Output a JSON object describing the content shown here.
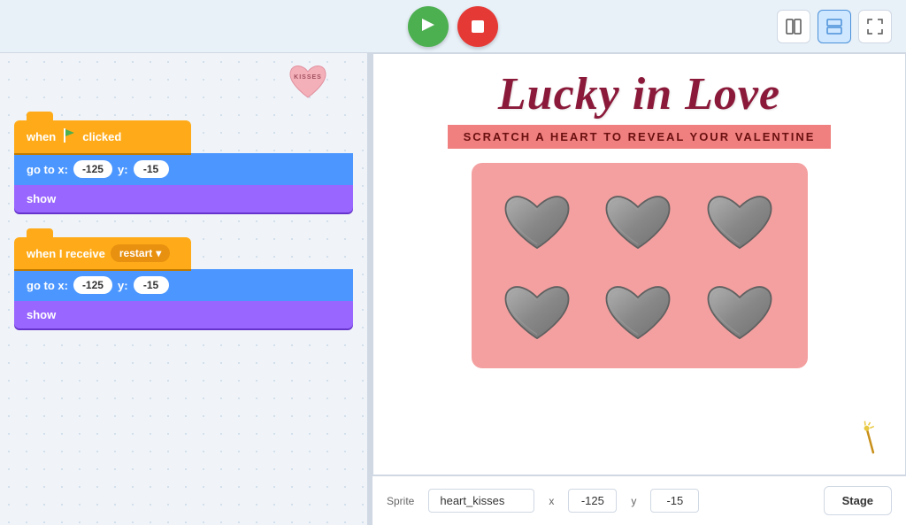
{
  "topbar": {
    "flag_label": "Green Flag",
    "stop_label": "Stop",
    "layout_btn": "Layout",
    "split_btn": "Split View",
    "fullscreen_btn": "Fullscreen"
  },
  "code_panel": {
    "block_group_1": {
      "hat_text": "when",
      "hat_suffix": "clicked",
      "motion_label": "go to x:",
      "x_val": "-125",
      "y_label": "y:",
      "y_val": "-15",
      "looks_label": "show"
    },
    "block_group_2": {
      "hat_text": "when I receive",
      "dropdown_val": "restart",
      "motion_label": "go to x:",
      "x_val": "-125",
      "y_label": "y:",
      "y_val": "-15",
      "looks_label": "show"
    },
    "sprite_kisses_label": "KISSES"
  },
  "game": {
    "title": "Lucky in Love",
    "subtitle": "SCRATCH A HEART TO REVEAL YOUR VALENTINE",
    "hearts_count": 6
  },
  "bottom_bar": {
    "sprite_label": "Sprite",
    "sprite_name": "heart_kisses",
    "x_label": "x",
    "x_val": "-125",
    "y_label": "y",
    "y_val": "-15",
    "stage_tab": "Stage"
  },
  "icons": {
    "flag": "▶",
    "stop": "⬛",
    "layout": "▣",
    "split": "⊟",
    "fullscreen": "⤢",
    "wand": "✦",
    "dropdown_arrow": "▾"
  }
}
